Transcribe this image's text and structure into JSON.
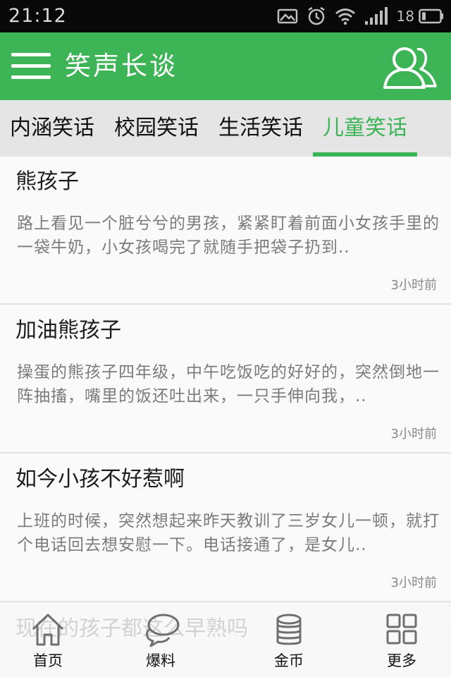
{
  "status_bar": {
    "time": "21:12",
    "battery_level": "18"
  },
  "header": {
    "title": "笑声长谈"
  },
  "tabs": [
    {
      "label": "内涵笑话",
      "active": false
    },
    {
      "label": "校园笑话",
      "active": false
    },
    {
      "label": "生活笑话",
      "active": false
    },
    {
      "label": "儿童笑话",
      "active": true
    }
  ],
  "jokes": [
    {
      "title": "熊孩子",
      "excerpt": "路上看见一个脏兮兮的男孩，紧紧盯着前面小女孩手里的一袋牛奶，小女孩喝完了就随手把袋子扔到..",
      "time": "3小时前"
    },
    {
      "title": "加油熊孩子",
      "excerpt": "操蛋的熊孩子四年级，中午吃饭吃的好好的，突然倒地一阵抽搐，嘴里的饭还吐出来，一只手伸向我，..",
      "time": "3小时前"
    },
    {
      "title": "如今小孩不好惹啊",
      "excerpt": "上班的时候，突然想起来昨天教训了三岁女儿一顿，就打个电话回去想安慰一下。电话接通了，是女儿..",
      "time": "3小时前"
    },
    {
      "title": "现在的孩子都这么早熟吗"
    }
  ],
  "bottom_nav": [
    {
      "label": "首页",
      "icon": "home-icon"
    },
    {
      "label": "爆料",
      "icon": "chat-bubble-icon"
    },
    {
      "label": "金币",
      "icon": "coin-stack-icon"
    },
    {
      "label": "更多",
      "icon": "grid-icon"
    }
  ],
  "colors": {
    "accent": "#3db456",
    "status_bar_bg": "#080808",
    "tab_bar_bg": "#e5e5e5",
    "card_bg": "#fafafa",
    "excerpt_text": "#7b7b7b"
  }
}
